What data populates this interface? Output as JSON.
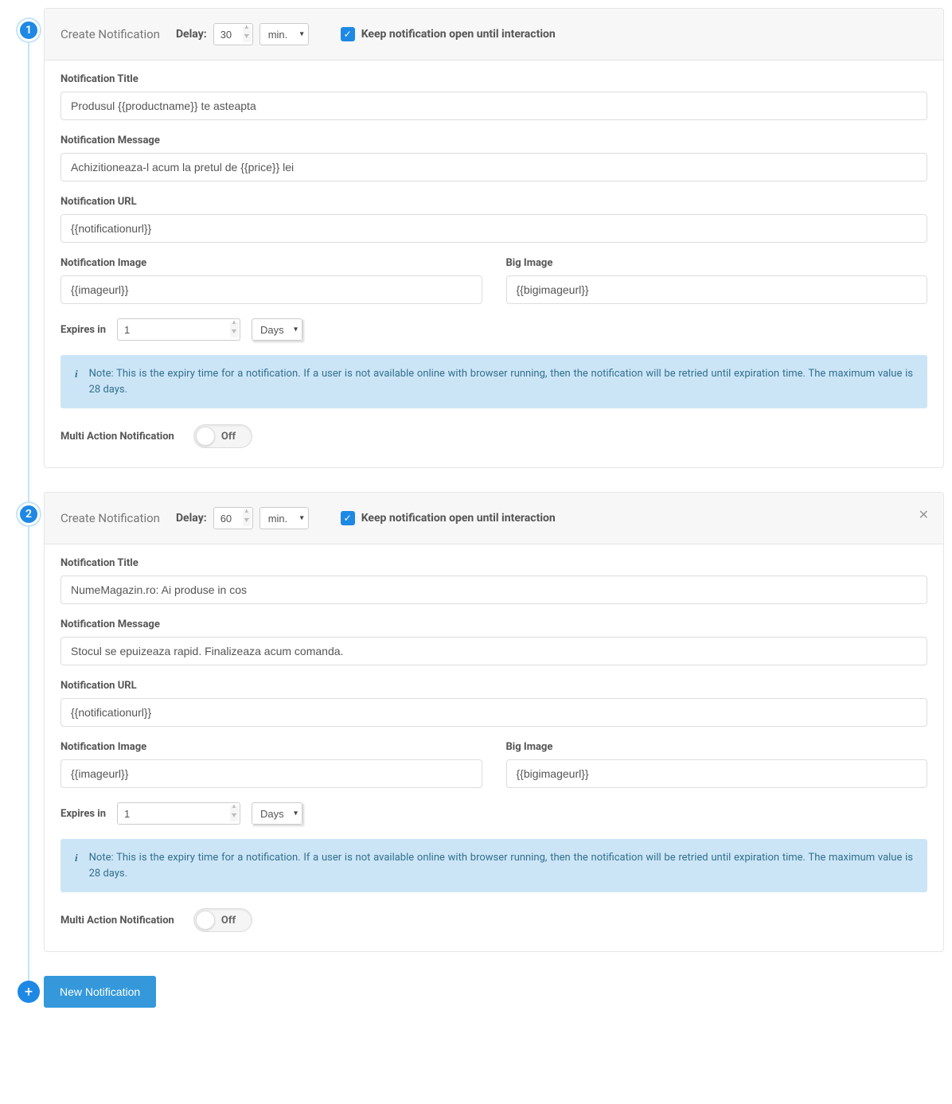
{
  "steps": [
    {
      "number": "1",
      "header": {
        "title": "Create Notification",
        "delay_label": "Delay:",
        "delay_value": "30",
        "delay_unit": "min.",
        "keep_open_label": "Keep notification open until interaction",
        "keep_open_checked": true,
        "closable": false
      },
      "fields": {
        "title_label": "Notification Title",
        "title_value": "Produsul {{productname}} te asteapta",
        "message_label": "Notification Message",
        "message_value": "Achizitioneaza-l acum la pretul de {{price}} lei",
        "url_label": "Notification URL",
        "url_value": "{{notificationurl}}",
        "image_label": "Notification Image",
        "image_value": "{{imageurl}}",
        "bigimage_label": "Big Image",
        "bigimage_value": "{{bigimageurl}}",
        "expires_label": "Expires in",
        "expires_value": "1",
        "expires_unit": "Days",
        "note": "Note: This is the expiry time for a notification. If a user is not available online with browser running, then the notification will be retried until expiration time. The maximum value is 28 days.",
        "multi_label": "Multi Action Notification",
        "multi_state": "Off"
      }
    },
    {
      "number": "2",
      "header": {
        "title": "Create Notification",
        "delay_label": "Delay:",
        "delay_value": "60",
        "delay_unit": "min.",
        "keep_open_label": "Keep notification open until interaction",
        "keep_open_checked": true,
        "closable": true
      },
      "fields": {
        "title_label": "Notification Title",
        "title_value": "NumeMagazin.ro: Ai produse in cos",
        "message_label": "Notification Message",
        "message_value": "Stocul se epuizeaza rapid. Finalizeaza acum comanda.",
        "url_label": "Notification URL",
        "url_value": "{{notificationurl}}",
        "image_label": "Notification Image",
        "image_value": "{{imageurl}}",
        "bigimage_label": "Big Image",
        "bigimage_value": "{{bigimageurl}}",
        "expires_label": "Expires in",
        "expires_value": "1",
        "expires_unit": "Days",
        "note": "Note: This is the expiry time for a notification. If a user is not available online with browser running, then the notification will be retried until expiration time. The maximum value is 28 days.",
        "multi_label": "Multi Action Notification",
        "multi_state": "Off"
      }
    }
  ],
  "footer": {
    "add_symbol": "+",
    "new_button": "New Notification"
  }
}
